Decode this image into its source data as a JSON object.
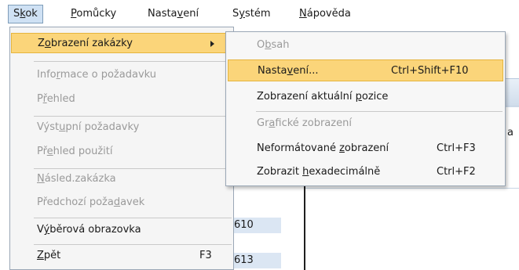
{
  "menubar": {
    "items": [
      {
        "pre": "S",
        "ul": "k",
        "post": "ok"
      },
      {
        "pre": "",
        "ul": "P",
        "post": "omůcky"
      },
      {
        "pre": "Nasta",
        "ul": "v",
        "post": "ení"
      },
      {
        "pre": "S",
        "ul": "y",
        "post": "stém"
      },
      {
        "pre": "",
        "ul": "N",
        "post": "ápověda"
      }
    ]
  },
  "menu": {
    "items": [
      {
        "pre": "Z",
        "ul": "o",
        "post": "brazení zakázky"
      },
      {
        "pre": "Info",
        "ul": "r",
        "post": "mace o požadavku"
      },
      {
        "pre": "P",
        "ul": "ř",
        "post": "ehled"
      },
      {
        "pre": "Výst",
        "ul": "u",
        "post": "pní požadavky"
      },
      {
        "pre": "Př",
        "ul": "e",
        "post": "hled použití"
      },
      {
        "pre": "",
        "ul": "N",
        "post": "ásled.zakázka"
      },
      {
        "pre": "Předchozí poža",
        "ul": "d",
        "post": "avek"
      },
      {
        "pre": "V",
        "ul": "ý",
        "post": "běrová obrazovka"
      },
      {
        "pre": "",
        "ul": "Z",
        "post": "pět",
        "shortcut": "F3"
      }
    ]
  },
  "submenu": {
    "items": [
      {
        "pre": "O",
        "ul": "b",
        "post": "sah",
        "shortcut": ""
      },
      {
        "pre": "Nasta",
        "ul": "v",
        "post": "ení...",
        "shortcut": "Ctrl+Shift+F10"
      },
      {
        "pre": "Zobrazení aktuální ",
        "ul": "p",
        "post": "ozice",
        "shortcut": ""
      },
      {
        "pre": "Gr",
        "ul": "a",
        "post": "fické zobrazení",
        "shortcut": ""
      },
      {
        "pre": "Neformátované ",
        "ul": "z",
        "post": "obrazení",
        "shortcut": "Ctrl+F3"
      },
      {
        "pre": "Zobrazit ",
        "ul": "h",
        "post": "exadecimálně",
        "shortcut": "Ctrl+F2"
      }
    ]
  },
  "background": {
    "cell1": "610",
    "cell2": "613",
    "header_fragment": "a"
  }
}
